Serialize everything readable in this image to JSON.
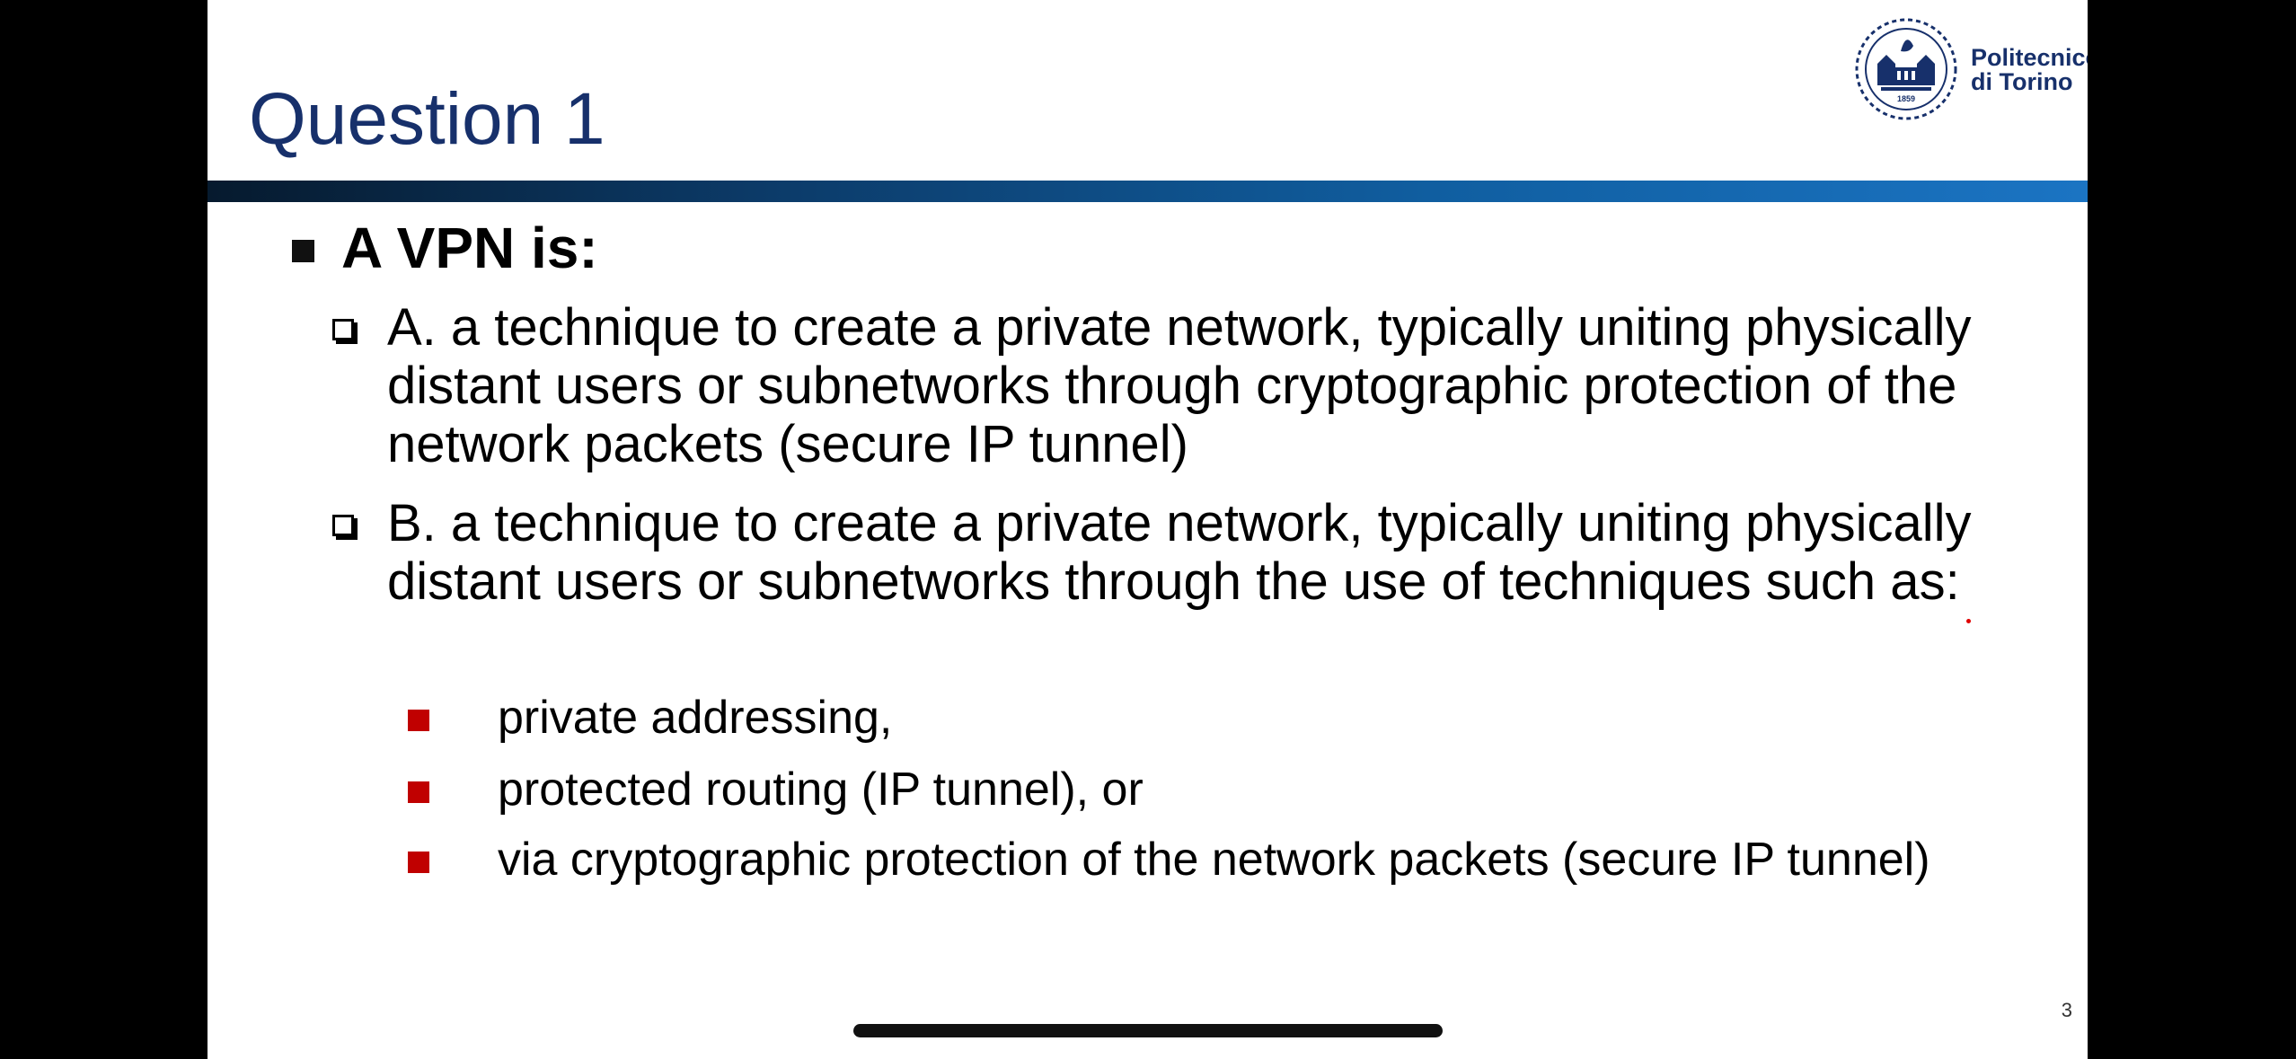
{
  "slide": {
    "title": "Question 1",
    "logo": {
      "name_line1": "Politecnico",
      "name_line2": "di Torino",
      "seal_year": "1859"
    },
    "question": "A VPN is:",
    "options": [
      {
        "text": "A. a technique to create a private network, typically uniting physically distant users or subnetworks through cryptographic protection of the network packets (secure IP tunnel)"
      },
      {
        "text": "B. a technique to create a private network, typically uniting physically distant users or subnetworks through the use of techniques such as:",
        "sub_items": [
          "private addressing,",
          "protected routing (IP tunnel), or",
          "via cryptographic protection of the network packets (secure IP tunnel)"
        ]
      }
    ],
    "page_number": "3"
  },
  "colors": {
    "title": "#17306b",
    "accent_bar": "#1b74c3",
    "sub_bullet": "#c00000",
    "background": "#000000"
  },
  "icons": {
    "logo": "politecnico-seal-icon",
    "question_bullet": "black-square-icon",
    "option_bullet": "hollow-square-shadow-icon",
    "sub_bullet": "red-square-icon"
  }
}
